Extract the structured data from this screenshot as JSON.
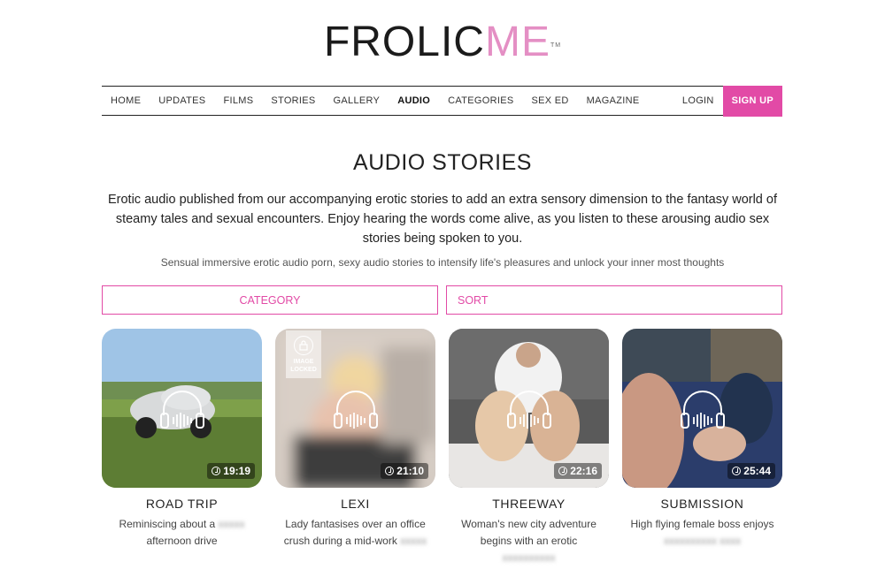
{
  "logo": {
    "part1": "FROLIC",
    "part2": "ME",
    "tm": "TM"
  },
  "nav": {
    "items": [
      "HOME",
      "UPDATES",
      "FILMS",
      "STORIES",
      "GALLERY",
      "AUDIO",
      "CATEGORIES",
      "SEX ED",
      "MAGAZINE"
    ],
    "active": "AUDIO",
    "login": "LOGIN",
    "signup": "SIGN UP"
  },
  "page": {
    "title": "AUDIO STORIES",
    "intro": "Erotic audio published from our accompanying erotic stories to add an extra sensory dimension to the fantasy world of steamy tales and sexual encounters. Enjoy hearing the words come alive, as you listen to these arousing audio sex stories being spoken to you.",
    "subtitle": "Sensual immersive erotic audio porn, sexy audio stories to intensify life's pleasures and unlock your inner most thoughts"
  },
  "filters": {
    "category": "CATEGORY",
    "sort": "SORT"
  },
  "colors": {
    "accent": "#e24aa6",
    "logo_pink": "#e48fc4"
  },
  "cards": [
    {
      "title": "ROAD TRIP",
      "desc_visible": "Reminiscing about a",
      "desc_blurred": "xxxxx",
      "desc2": "afternoon drive",
      "duration": "19:19",
      "locked": false
    },
    {
      "title": "LEXI",
      "desc_visible": "Lady fantasises over an office",
      "desc2": "crush during a mid-work",
      "desc_blurred": "xxxxx",
      "duration": "21:10",
      "locked": true,
      "lock_label": "IMAGE LOCKED"
    },
    {
      "title": "THREEWAY",
      "desc_visible": "Woman's new city adventure",
      "desc2": "begins with an erotic",
      "desc_blurred": "xxxxxxxxxx",
      "duration": "22:16",
      "locked": false
    },
    {
      "title": "SUBMISSION",
      "desc_visible": "High flying female boss enjoys",
      "desc_blurred": "xxxxxxxxxx xxxx",
      "duration": "25:44",
      "locked": false
    }
  ]
}
